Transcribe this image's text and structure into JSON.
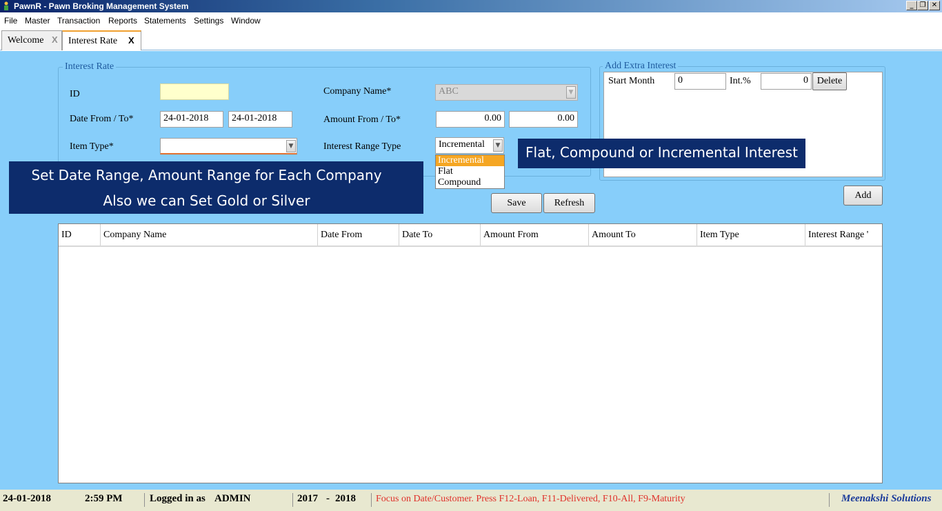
{
  "window": {
    "title": "PawnR - Pawn Broking Management System"
  },
  "menu": [
    "File",
    "Master",
    "Transaction",
    "Reports",
    "Statements",
    "Settings",
    "Window"
  ],
  "tabs": [
    {
      "label": "Welcome",
      "close": "X"
    },
    {
      "label": "Interest Rate",
      "close": "X"
    }
  ],
  "form": {
    "legend": "Interest Rate",
    "id_label": "ID",
    "id_value": "",
    "date_label": "Date From / To*",
    "date_from": "24-01-2018",
    "date_to": "24-01-2018",
    "item_type_label": "Item Type*",
    "item_type_value": "",
    "company_label": "Company Name*",
    "company_value": "ABC",
    "amount_label": "Amount From / To*",
    "amount_from": "0.00",
    "amount_to": "0.00",
    "range_type_label": "Interest Range Type",
    "range_type_value": "Incremental",
    "range_type_options": [
      "Incremental",
      "Flat",
      "Compound"
    ]
  },
  "extra": {
    "legend": "Add Extra Interest",
    "start_month_label": "Start Month",
    "start_month_value": "0",
    "int_label": "Int.%",
    "int_value": "0",
    "delete_label": "Delete",
    "add_label": "Add"
  },
  "buttons": {
    "save": "Save",
    "refresh": "Refresh"
  },
  "callouts": {
    "left_line1": "Set Date Range, Amount Range for Each Company",
    "left_line2": "Also we can Set Gold or Silver",
    "right": "Flat, Compound or Incremental Interest"
  },
  "grid": {
    "columns": [
      "ID",
      "Company Name",
      "Date From",
      "Date To",
      "Amount From",
      "Amount To",
      "Item Type",
      "Interest Range '"
    ]
  },
  "status": {
    "date": "24-01-2018",
    "time": "2:59 PM",
    "logged_label": "Logged in as",
    "user": "ADMIN",
    "year_from": "2017",
    "year_sep": "-",
    "year_to": "2018",
    "hint": "Focus on Date/Customer. Press F12-Loan, F11-Delivered, F10-All, F9-Maturity",
    "brand": "Meenakshi Solutions"
  },
  "colors": {
    "background": "#87cefa",
    "callout": "#0d2c6c",
    "dropdown_selected": "#f5a623",
    "status_hint": "#e0302a",
    "brand": "#1a3a9a"
  }
}
